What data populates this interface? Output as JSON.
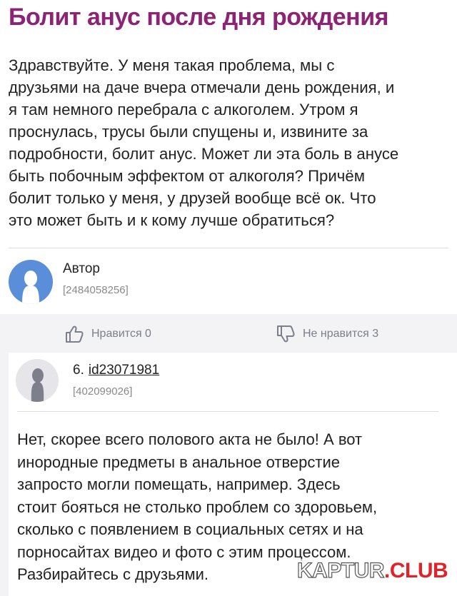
{
  "title": "Болит анус после дня рождения",
  "question": {
    "lines": [
      "Здравствуйте. У меня такая проблема, мы с",
      "друзьями на даче вчера отмечали день рождения, и",
      "я там немного перебрала с алкоголем. Утром я",
      "проснулась, трусы были спущены и, извините за",
      "подробности, болит анус. Может ли эта боль в анусе",
      "быть побочным эффектом от алкоголя? Причём",
      "болит только у меня, у друзей вообще всё ок. Что",
      "это может быть и к кому лучше обратиться?"
    ]
  },
  "author": {
    "name": "Автор",
    "id": "[2484058256]",
    "avatar_icon": "user-silhouette-icon",
    "avatar_color": "#5b8ed8"
  },
  "reactions": {
    "like_label": "Нравится 0",
    "dislike_label": "Не нравится 3",
    "like_icon": "thumbs-up-icon",
    "dislike_icon": "thumbs-down-icon"
  },
  "reply": {
    "number": "6.",
    "user": "id23071981",
    "id": "[402099026]",
    "lines": [
      "Нет, скорее всего полового акта не было! А вот",
      "инородные предметы в анальное отверстие",
      "запросто могли помещать, например. Здесь",
      "стоит бояться не столько проблем со здоровьем,",
      "сколько с появлением в социальных сетях и на",
      "порносайтах видео и фото с этим процессом.",
      "Разбирайтесь с друзьями."
    ]
  },
  "watermark": {
    "part1": "KAPTUR",
    "part2": ".CLUB"
  },
  "colors": {
    "title": "#8c2374",
    "watermark_accent": "#e0232b"
  }
}
